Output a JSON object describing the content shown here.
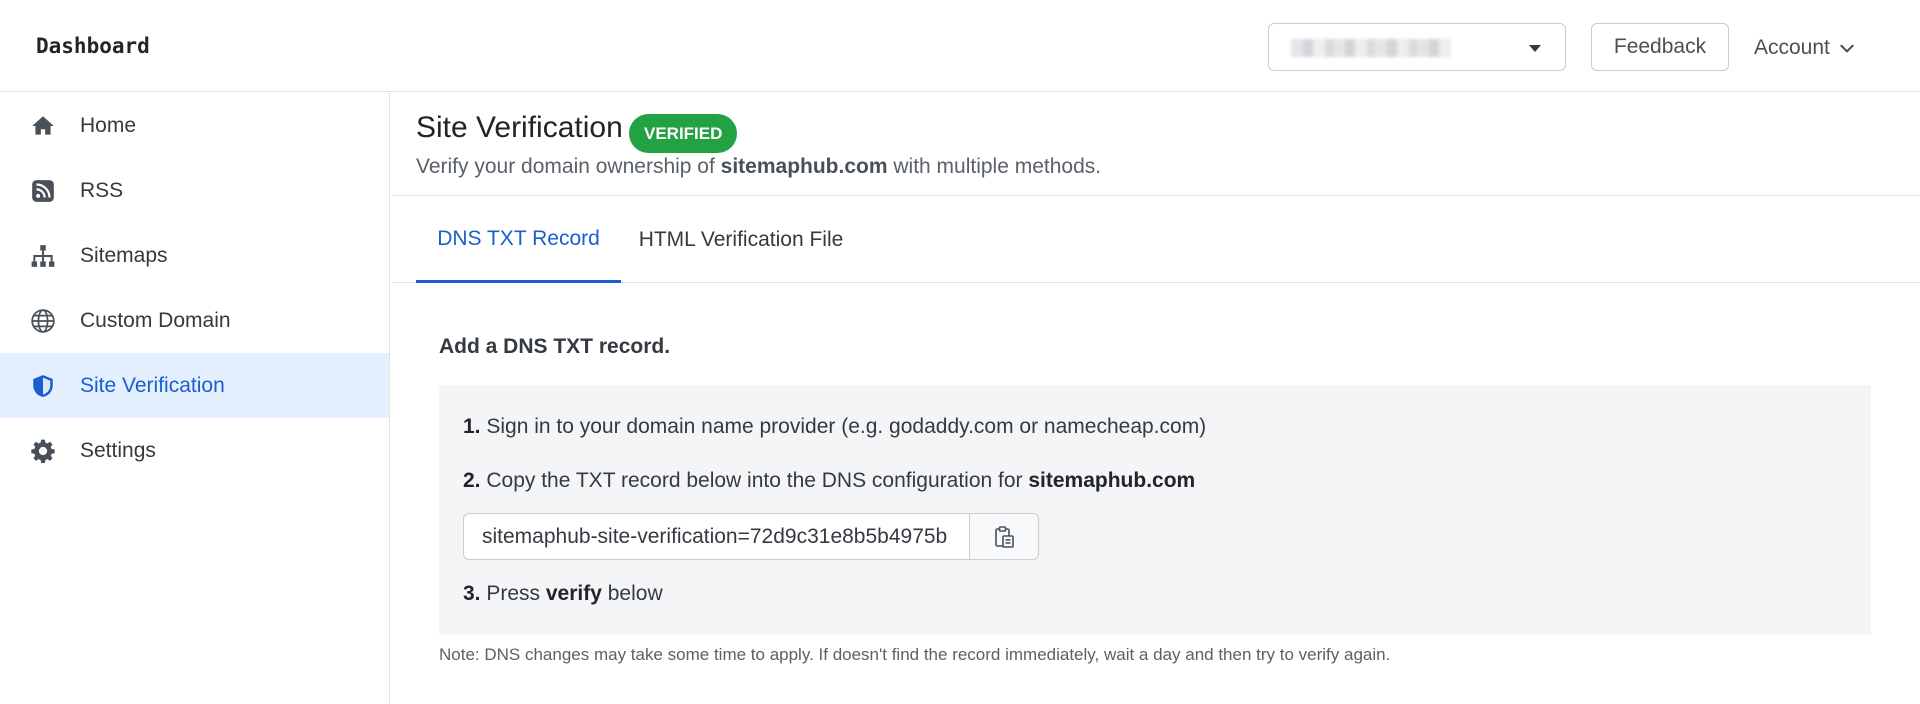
{
  "header": {
    "brand": "Dashboard",
    "site_selector_icon": "chevron-down-icon",
    "feedback_label": "Feedback",
    "account_label": "Account"
  },
  "sidebar": {
    "items": [
      {
        "label": "Home",
        "icon": "home-icon"
      },
      {
        "label": "RSS",
        "icon": "rss-icon"
      },
      {
        "label": "Sitemaps",
        "icon": "sitemap-icon"
      },
      {
        "label": "Custom Domain",
        "icon": "globe-icon"
      },
      {
        "label": "Site Verification",
        "icon": "shield-icon",
        "active": true
      },
      {
        "label": "Settings",
        "icon": "gear-icon"
      }
    ]
  },
  "page": {
    "title": "Site Verification",
    "badge": "VERIFIED",
    "subtitle_prefix": "Verify your domain ownership of ",
    "subtitle_domain": "sitemaphub.com",
    "subtitle_suffix": " with multiple methods."
  },
  "tabs": [
    {
      "label": "DNS TXT Record",
      "active": true
    },
    {
      "label": "HTML Verification File",
      "active": false
    }
  ],
  "dns": {
    "heading": "Add a DNS TXT record.",
    "step1_num": "1.",
    "step1_text": " Sign in to your domain name provider (e.g. godaddy.com or namecheap.com)",
    "step2_num": "2.",
    "step2_text": " Copy the TXT record below into the DNS configuration for ",
    "step2_domain": "sitemaphub.com",
    "txt_record": "sitemaphub-site-verification=72d9c31e8b5b4975b",
    "copy_icon": "clipboard-icon",
    "step3_num": "3.",
    "step3_text_a": " Press ",
    "step3_bold": "verify",
    "step3_text_b": " below",
    "note": "Note: DNS changes may take some time to apply. If doesn't find the record immediately, wait a day and then try to verify again."
  },
  "colors": {
    "accent": "#1a5fd0",
    "active_bg": "#e4efff",
    "badge_bg": "#23a244",
    "box_bg": "#f4f5f7"
  }
}
